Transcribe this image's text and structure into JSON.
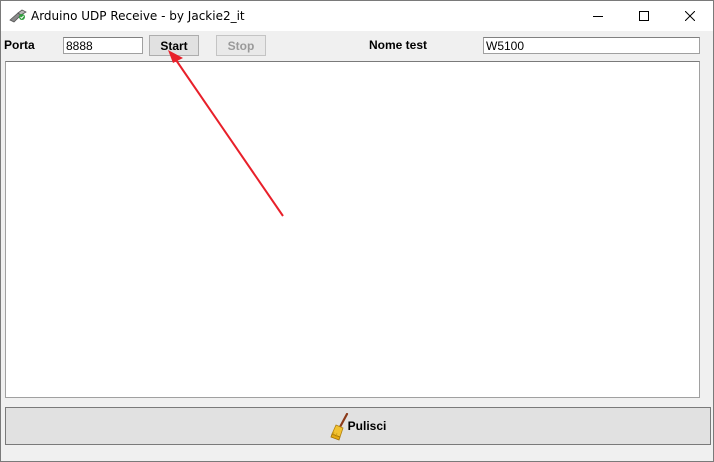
{
  "window": {
    "title": "Arduino UDP Receive - by Jackie2_it",
    "icon": "network-plug-icon",
    "controls": [
      "minimize-icon",
      "maximize-icon",
      "close-icon"
    ]
  },
  "toolbar": {
    "port_label": "Porta",
    "port_value": "8888",
    "start_label": "Start",
    "stop_label": "Stop",
    "test_name_label": "Nome test",
    "test_name_value": "W5100"
  },
  "log": {
    "content": ""
  },
  "footer": {
    "clear_label": "Pulisci",
    "clear_icon": "broom-icon"
  },
  "annotation": {
    "type": "arrow",
    "color": "#e8202a",
    "points_to": "start-button"
  }
}
